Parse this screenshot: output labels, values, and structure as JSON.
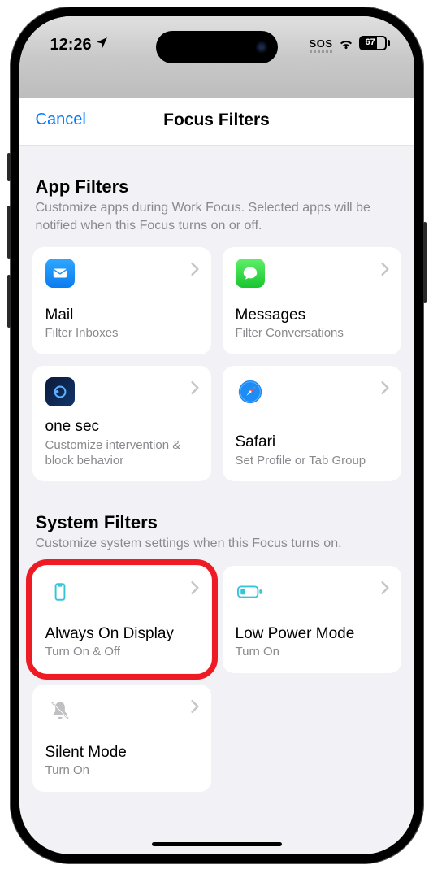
{
  "status": {
    "time": "12:26",
    "sos": "SOS",
    "battery": "67"
  },
  "navbar": {
    "cancel": "Cancel",
    "title": "Focus Filters"
  },
  "sections": {
    "app": {
      "title": "App Filters",
      "desc": "Customize apps during Work Focus. Selected apps will be notified when this Focus turns on or off."
    },
    "system": {
      "title": "System Filters",
      "desc": "Customize system settings when this Focus turns on."
    }
  },
  "appFilters": [
    {
      "title": "Mail",
      "sub": "Filter Inboxes"
    },
    {
      "title": "Messages",
      "sub": "Filter Conversations"
    },
    {
      "title": "one sec",
      "sub": "Customize intervention & block behavior"
    },
    {
      "title": "Safari",
      "sub": "Set Profile or Tab Group"
    }
  ],
  "systemFilters": [
    {
      "title": "Always On Display",
      "sub": "Turn On & Off"
    },
    {
      "title": "Low Power Mode",
      "sub": "Turn On"
    },
    {
      "title": "Silent Mode",
      "sub": "Turn On"
    }
  ]
}
